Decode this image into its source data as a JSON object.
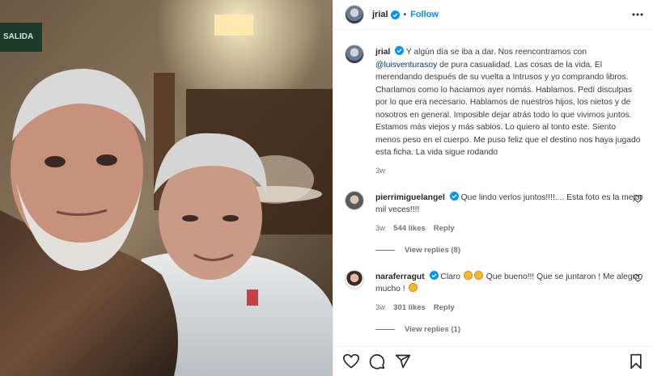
{
  "post": {
    "author": "jrial",
    "dot": "•",
    "follow_label": "Follow",
    "caption_text": "Y algún día se iba a dar. Nos reencontramos con ",
    "caption_mention": "@luisventurasoy",
    "caption_rest": " de pura casualidad. Las cosas de la vida. El merendando después de su vuelta a Intrusos y yo comprando libros. Charlamos como lo haciamos ayer nomás. Hablamos. Pedí disculpas por lo que era necesario. Hablamos de nuestros hijos, los nietos y de nosotros en general. Imposible dejar atrás todo lo que vivimos juntos. Estamos más viejos y más sabios. Lo quiero al tonto este. Siento menos peso en el cuerpo. Me puso feliz que el destino nos haya jugado esta ficha. La vida sigue rodando",
    "caption_time": "3w",
    "photo_sign_text": "SALIDA"
  },
  "comments": [
    {
      "user": "pierrimiguelangel",
      "text": "Que lindo verlos juntos!!!!.... Esta foto es la mejor mil veces!!!!",
      "time": "3w",
      "likes": "544 likes",
      "reply": "Reply",
      "view_replies": "View replies (8)"
    },
    {
      "user": "naraferragut",
      "text_a": "Claro ",
      "text_b": " Que bueno!!! Que se juntaron ! Me alegra mucho ! ",
      "time": "3w",
      "likes": "301 likes",
      "reply": "Reply",
      "view_replies": "View replies (1)"
    }
  ],
  "icons": {
    "like": "heart-icon",
    "comment": "comment-icon",
    "share": "share-icon",
    "save": "bookmark-icon",
    "more": "more-horizontal-icon",
    "verified": "verified-badge-icon"
  },
  "colors": {
    "accent": "#0095f6",
    "verified": "#0095f6",
    "mention": "#00376b"
  }
}
